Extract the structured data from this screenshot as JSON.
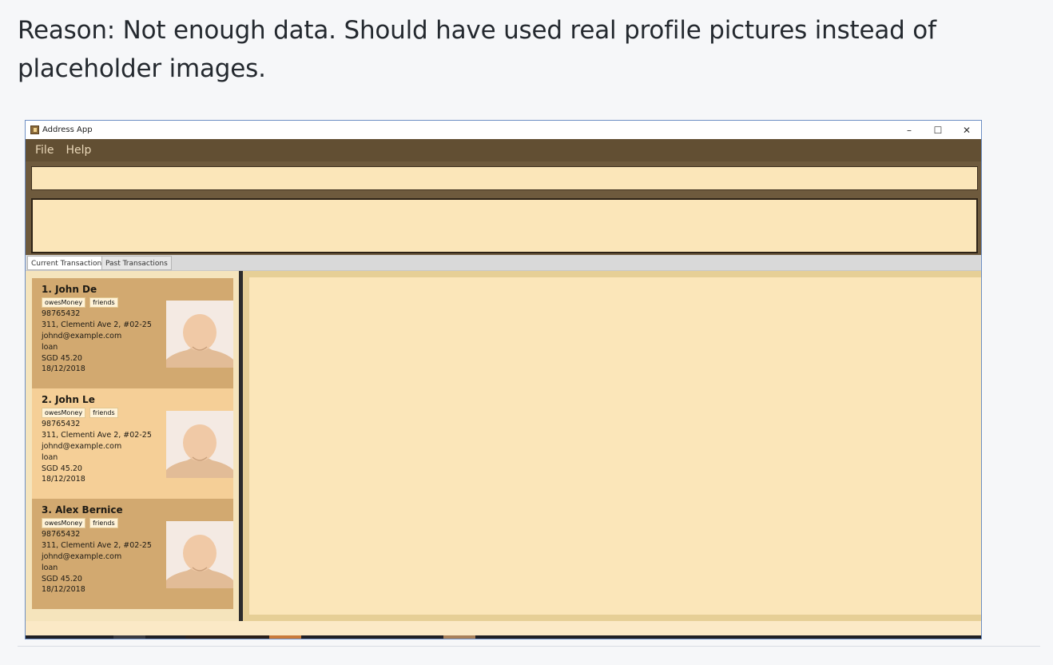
{
  "caption": "Reason: Not enough data. Should have used real profile pictures instead of placeholder images.",
  "window": {
    "title": "Address App",
    "controls": {
      "minimize": "–",
      "maximize": "☐",
      "close": "✕"
    }
  },
  "menu": {
    "file": "File",
    "help": "Help"
  },
  "tabs": {
    "current": "Current Transactions",
    "past": "Past Transactions"
  },
  "persons": [
    {
      "index_name": "1.  John De",
      "tags": [
        "owesMoney",
        "friends"
      ],
      "phone": "98765432",
      "address": "311, Clementi Ave 2, #02-25",
      "email": "johnd@example.com",
      "type": "loan",
      "amount": "SGD 45.20",
      "date": "18/12/2018"
    },
    {
      "index_name": "2.  John Le",
      "tags": [
        "owesMoney",
        "friends"
      ],
      "phone": "98765432",
      "address": "311, Clementi Ave 2, #02-25",
      "email": "johnd@example.com",
      "type": "loan",
      "amount": "SGD 45.20",
      "date": "18/12/2018"
    },
    {
      "index_name": "3.  Alex Bernice",
      "tags": [
        "owesMoney",
        "friends"
      ],
      "phone": "98765432",
      "address": "311, Clementi Ave 2, #02-25",
      "email": "johnd@example.com",
      "type": "loan",
      "amount": "SGD 45.20",
      "date": "18/12/2018"
    }
  ],
  "colors": {
    "menubar": "#624f33",
    "card_dark": "#d2a970",
    "card_light": "#f5cf97",
    "panel": "#fbe6b9"
  },
  "icons": {
    "avatar": "person-silhouette-icon",
    "app": "address-book-icon"
  }
}
